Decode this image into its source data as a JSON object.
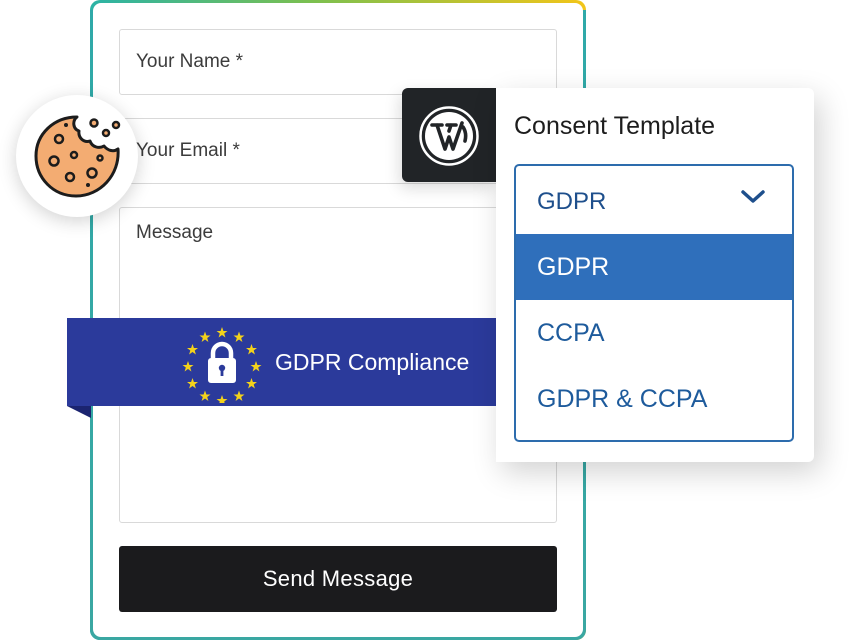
{
  "form": {
    "name_placeholder": "Your Name *",
    "email_placeholder": "Your Email *",
    "message_placeholder": "Message",
    "submit_label": "Send Message"
  },
  "ribbon": {
    "label": "GDPR Compliance"
  },
  "consent": {
    "title": "Consent Template",
    "selected": "GDPR",
    "options": [
      "GDPR",
      "CCPA",
      "GDPR & CCPA"
    ]
  },
  "colors": {
    "ribbon_blue": "#2b3a9b",
    "option_highlight": "#2f6fbb",
    "select_border": "#2d6cad",
    "button_dark": "#1b1b1d",
    "star_yellow": "#f4d21b",
    "cookie_fill": "#f3ac72"
  },
  "icons": {
    "cookie": "cookie-icon",
    "padlock": "padlock-icon",
    "eu_stars": "eu-stars-icon",
    "wordpress": "wordpress-icon",
    "chevron": "chevron-down-icon"
  }
}
